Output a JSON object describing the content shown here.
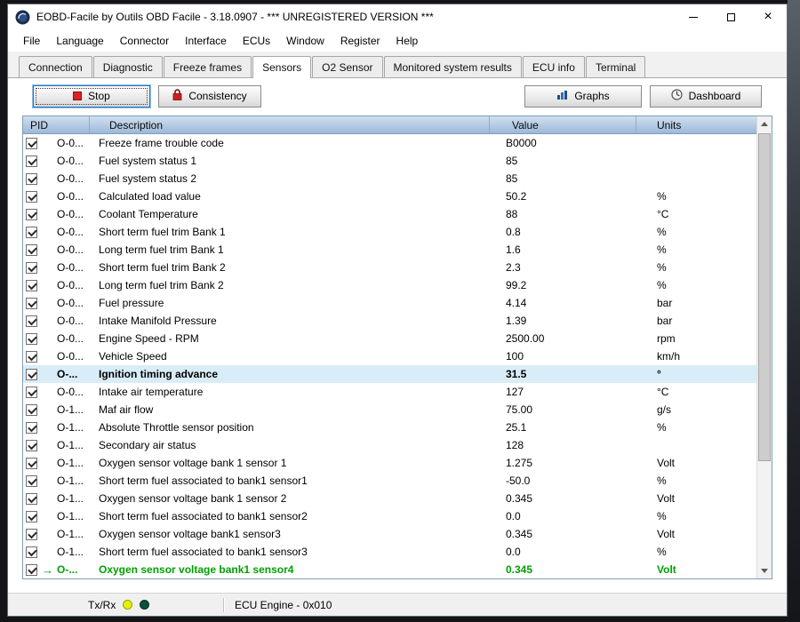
{
  "window": {
    "title": "EOBD-Facile by Outils OBD Facile - 3.18.0907 - *** UNREGISTERED VERSION ***"
  },
  "menu": {
    "items": [
      "File",
      "Language",
      "Connector",
      "Interface",
      "ECUs",
      "Window",
      "Register",
      "Help"
    ]
  },
  "tabs": {
    "active": "Sensors",
    "items": [
      "Connection",
      "Diagnostic",
      "Freeze frames",
      "Sensors",
      "O2 Sensor",
      "Monitored system results",
      "ECU info",
      "Terminal"
    ]
  },
  "toolbar": {
    "stop_label": "Stop",
    "consistency_label": "Consistency",
    "graphs_label": "Graphs",
    "dashboard_label": "Dashboard"
  },
  "table": {
    "headers": [
      "PID",
      "Description",
      "Value",
      "Units"
    ],
    "rows": [
      {
        "pid": "O-0...",
        "desc": "Freeze frame trouble code",
        "value": "B0000",
        "unit": ""
      },
      {
        "pid": "O-0...",
        "desc": "Fuel system status 1",
        "value": "85",
        "unit": ""
      },
      {
        "pid": "O-0...",
        "desc": "Fuel system status 2",
        "value": "85",
        "unit": ""
      },
      {
        "pid": "O-0...",
        "desc": "Calculated load value",
        "value": "50.2",
        "unit": "%"
      },
      {
        "pid": "O-0...",
        "desc": "Coolant Temperature",
        "value": "88",
        "unit": "°C"
      },
      {
        "pid": "O-0...",
        "desc": "Short term fuel trim Bank 1",
        "value": "0.8",
        "unit": "%"
      },
      {
        "pid": "O-0...",
        "desc": "Long term fuel trim Bank 1",
        "value": "1.6",
        "unit": "%"
      },
      {
        "pid": "O-0...",
        "desc": "Short term fuel trim Bank 2",
        "value": "2.3",
        "unit": "%"
      },
      {
        "pid": "O-0...",
        "desc": "Long term fuel trim Bank 2",
        "value": "99.2",
        "unit": "%"
      },
      {
        "pid": "O-0...",
        "desc": "Fuel pressure",
        "value": "4.14",
        "unit": "bar"
      },
      {
        "pid": "O-0...",
        "desc": "Intake Manifold Pressure",
        "value": "1.39",
        "unit": "bar"
      },
      {
        "pid": "O-0...",
        "desc": "Engine Speed - RPM",
        "value": "2500.00",
        "unit": "rpm"
      },
      {
        "pid": "O-0...",
        "desc": "Vehicle Speed",
        "value": "100",
        "unit": "km/h"
      },
      {
        "pid": "O-...",
        "desc": "Ignition timing advance",
        "value": "31.5",
        "unit": "°",
        "state": "selected"
      },
      {
        "pid": "O-0...",
        "desc": "Intake air temperature",
        "value": "127",
        "unit": "°C"
      },
      {
        "pid": "O-1...",
        "desc": "Maf air flow",
        "value": "75.00",
        "unit": "g/s"
      },
      {
        "pid": "O-1...",
        "desc": "Absolute Throttle sensor position",
        "value": "25.1",
        "unit": "%"
      },
      {
        "pid": "O-1...",
        "desc": "Secondary air status",
        "value": "128",
        "unit": ""
      },
      {
        "pid": "O-1...",
        "desc": "Oxygen sensor voltage bank 1 sensor 1",
        "value": "1.275",
        "unit": "Volt"
      },
      {
        "pid": "O-1...",
        "desc": "Short term fuel associated to bank1 sensor1",
        "value": "-50.0",
        "unit": "%"
      },
      {
        "pid": "O-1...",
        "desc": "Oxygen sensor voltage bank 1 sensor 2",
        "value": "0.345",
        "unit": "Volt"
      },
      {
        "pid": "O-1...",
        "desc": "Short term fuel associated to bank1 sensor2",
        "value": "0.0",
        "unit": "%"
      },
      {
        "pid": "O-1...",
        "desc": "Oxygen sensor voltage bank1 sensor3",
        "value": "0.345",
        "unit": "Volt"
      },
      {
        "pid": "O-1...",
        "desc": "Short term fuel associated to bank1 sensor3",
        "value": "0.0",
        "unit": "%"
      },
      {
        "pid": "O-...",
        "desc": "Oxygen sensor voltage bank1 sensor4",
        "value": "0.345",
        "unit": "Volt",
        "state": "green"
      }
    ]
  },
  "statusbar": {
    "txrx_label": "Tx/Rx",
    "ecu_label": "ECU Engine - 0x010"
  },
  "colors": {
    "selected_row_bg": "#D9EDF8",
    "live_row_green": "#00A000",
    "header_blue": "#9CB9D9",
    "stop_icon_red": "#DD2222",
    "led_yellow": "#E4F000",
    "led_dark_green": "#0D4F3C"
  }
}
